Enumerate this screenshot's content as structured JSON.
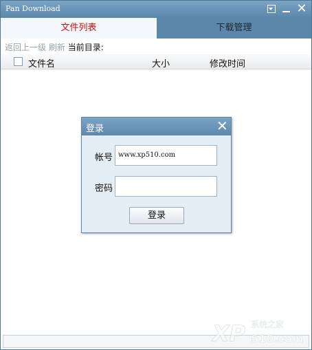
{
  "window": {
    "title": "Pan Download"
  },
  "titlebar": {
    "menu_icon": "dropdown-menu-icon",
    "minimize_icon": "minimize-icon",
    "close_glyph": "✕"
  },
  "tabs": [
    {
      "label": "文件列表",
      "active": true
    },
    {
      "label": "下载管理",
      "active": false
    }
  ],
  "toolbar": {
    "back_label": "返回上一级",
    "refresh_label": "刷新",
    "current_dir_label": "当前目录:"
  },
  "file_table": {
    "columns": [
      "文件名",
      "大小",
      "修改时间"
    ],
    "rows": []
  },
  "login_dialog": {
    "title": "登录",
    "close_glyph": "✕",
    "account_label": "帐号",
    "account_value": "www.xp510.com",
    "password_label": "密码",
    "password_value": "",
    "submit_label": "登录"
  },
  "watermark": {
    "text": "xp510.com",
    "chinese": "系统之家"
  },
  "colors": {
    "title_bar": "#5b87ab",
    "active_tab_text": "#cc1111",
    "dialog_bg": "#e6eef5"
  }
}
